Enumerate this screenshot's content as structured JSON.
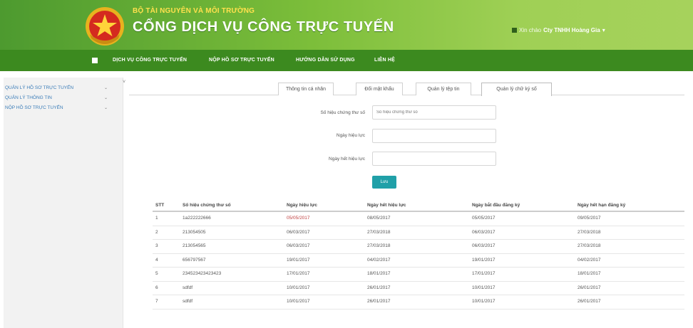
{
  "header": {
    "ministry": "BỘ TÀI NGUYÊN VÀ MÔI TRƯỜNG",
    "portal_title": "CỔNG DỊCH VỤ CÔNG TRỰC TUYẾN",
    "greeting": "Xin chào",
    "user_name": "Cty TNHH Hoàng Gia",
    "user_menu_caret": "▾"
  },
  "nav": {
    "items": [
      {
        "label": "DỊCH VỤ CÔNG TRỰC TUYẾN"
      },
      {
        "label": "NỘP HỒ SƠ TRỰC TUYẾN"
      },
      {
        "label": "HƯỚNG DẪN SỬ DỤNG"
      },
      {
        "label": "LIÊN HỆ"
      }
    ]
  },
  "sidebar": {
    "items": [
      {
        "label": "QUẢN LÝ HỒ SƠ TRỰC TUYẾN",
        "chevron": "⌄"
      },
      {
        "label": "QUẢN LÝ THÔNG TIN",
        "chevron": "⌄"
      },
      {
        "label": "NỘP HỒ SƠ TRỰC TUYẾN",
        "chevron": "⌄"
      }
    ],
    "collapse_glyph": "˅"
  },
  "tabs": [
    {
      "label": "Thông tin cá nhân"
    },
    {
      "label": "Đổi mật khẩu"
    },
    {
      "label": "Quản lý tệp tin"
    },
    {
      "label": "Quản lý chữ ký số"
    }
  ],
  "form": {
    "serial_label": "Số hiệu chứng thư số",
    "serial_placeholder": "Số hiệu chứng thư số",
    "valid_from_label": "Ngày hiệu lực",
    "valid_to_label": "Ngày hết hiệu lực",
    "submit_label": "Lưu"
  },
  "table": {
    "headers": [
      "STT",
      "Số hiệu chứng thư số",
      "Ngày hiệu lực",
      "Ngày hết hiệu lực",
      "Ngày bắt đầu đăng ký",
      "Ngày hết hạn đăng ký"
    ],
    "rows": [
      [
        "1",
        "1a222222666",
        "05/05/2017",
        "08/05/2017",
        "05/05/2017",
        "09/05/2017"
      ],
      [
        "2",
        "213054505",
        "06/03/2017",
        "27/03/2018",
        "06/03/2017",
        "27/03/2018"
      ],
      [
        "3",
        "213054565",
        "06/03/2017",
        "27/03/2018",
        "06/03/2017",
        "27/03/2018"
      ],
      [
        "4",
        "656797567",
        "19/01/2017",
        "04/02/2017",
        "19/01/2017",
        "04/02/2017"
      ],
      [
        "5",
        "234523423423423",
        "17/01/2017",
        "18/01/2017",
        "17/01/2017",
        "18/01/2017"
      ],
      [
        "6",
        "sdfdf",
        "10/01/2017",
        "26/01/2017",
        "10/01/2017",
        "26/01/2017"
      ],
      [
        "7",
        "sdfdf",
        "10/01/2017",
        "26/01/2017",
        "10/01/2017",
        "26/01/2017"
      ]
    ]
  },
  "colors": {
    "header_green": "#4d9a2f",
    "nav_green": "#3c8a1f",
    "ministry_yellow": "#ffe14d",
    "button_teal": "#20a0a8",
    "link_blue": "#3a7cb8"
  }
}
